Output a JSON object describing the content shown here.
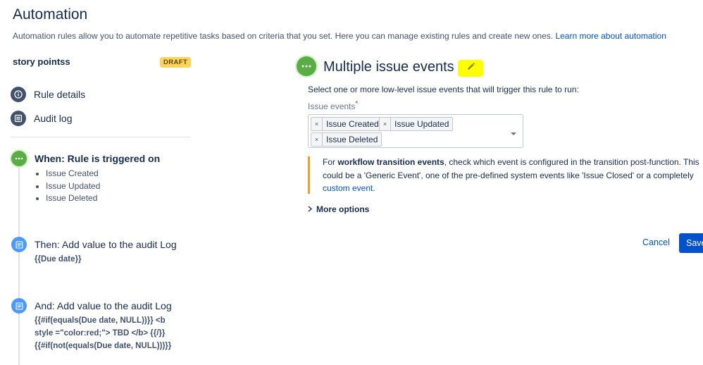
{
  "page": {
    "title": "Automation",
    "description": "Automation rules allow you to automate repetitive tasks based on criteria that you set. Here you can manage existing rules and create new ones.",
    "learn_more": "Learn more about automation"
  },
  "rule": {
    "name": "story pointss",
    "status_badge": "DRAFT"
  },
  "sidebar": {
    "items": [
      {
        "label": "Rule details",
        "icon": "info-icon"
      },
      {
        "label": "Audit log",
        "icon": "list-icon"
      }
    ]
  },
  "steps": [
    {
      "title": "When: Rule is triggered on",
      "icon": "trigger-icon",
      "items": [
        "Issue Created",
        "Issue Updated",
        "Issue Deleted"
      ]
    },
    {
      "title": "Then: Add value to the audit Log",
      "icon": "audit-icon",
      "lines": [
        "{{Due date}}"
      ]
    },
    {
      "title": "And: Add value to the audit Log",
      "icon": "audit-icon",
      "lines": [
        "{{#if(equals(Due date, NULL))}} <b",
        "style =\"color:red;\"> TBD </b> {{/}}",
        "{{#if(not(equals(Due date, NULL)))}}"
      ]
    }
  ],
  "panel": {
    "title": "Multiple issue events",
    "instruction": "Select one or more low-level issue events that will trigger this rule to run:",
    "field_label": "Issue events",
    "required_marker": "*",
    "selected_events": [
      "Issue Created",
      "Issue Updated",
      "Issue Deleted"
    ],
    "tag_remove_glyph": "×",
    "note": {
      "prefix": "For ",
      "bold": "workflow transition events",
      "line1_rest": ", check which event is configured in the transition post-function. This",
      "line2": "could be a 'Generic Event', one of the pre-defined system events like 'Issue Closed' or a completely",
      "link": "custom event",
      "suffix": "."
    },
    "more_options": "More options",
    "cancel_label": "Cancel",
    "save_label": "Save"
  },
  "colors": {
    "brand_blue": "#0052cc",
    "trigger_green": "#5aac44",
    "action_blue": "#4c9aff",
    "draft_yellow": "#ffd45c",
    "highlight": "#ffff00",
    "warning_orange": "#ff991f"
  }
}
